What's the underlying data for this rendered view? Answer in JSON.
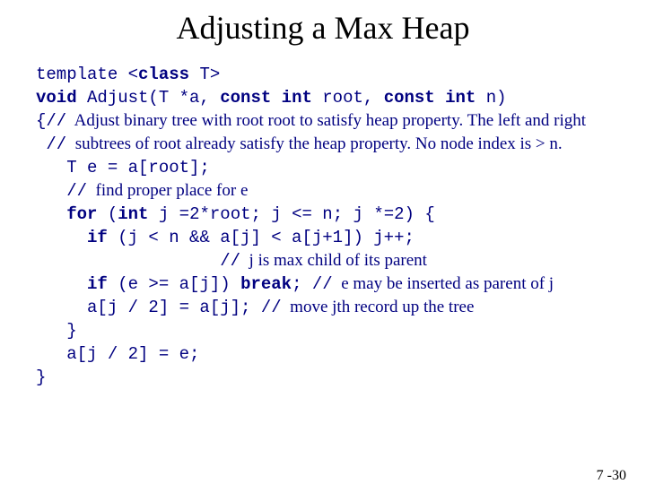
{
  "title": "Adjusting a Max Heap",
  "page_number": "7 -30",
  "code": {
    "l1a": "template ",
    "l1b": "<",
    "l1c": "class",
    "l1d": " T>",
    "l2a": "void",
    "l2b": " Adjust(T *a, ",
    "l2c": "const int",
    "l2d": " root, ",
    "l2e": "const int",
    "l2f": " n)",
    "l3a": "{",
    "l3b": "//",
    "c3": "  Adjust binary tree with root root to satisfy heap property. The left and right",
    "l4a": " //",
    "c4": "  subtrees of root already satisfy the heap property. No node index is > n.",
    "l5": "   T e = a[root];",
    "l6a": "   ",
    "l6b": "//",
    "c6": "  find proper place for e",
    "l7a": "   ",
    "l7b": "for",
    "l7c": " (",
    "l7d": "int",
    "l7e": " j =",
    "l7f": "2",
    "l7g": "*root; j <= n; j *=",
    "l7h": "2",
    "l7i": ") {",
    "l8a": "     ",
    "l8b": "if",
    "l8c": " (j < n && a[j] < a[j+",
    "l8d": "1",
    "l8e": "]) j++;",
    "l9a": "                  ",
    "l9b": "//",
    "c9": "  j is max child of its parent",
    "l10a": "     ",
    "l10b": "if",
    "l10c": " (e >= a[j]) ",
    "l10d": "break",
    "l10e": "; ",
    "l10f": "//",
    "c10": "  e may be inserted as parent of j",
    "l11a": "     a[j / ",
    "l11b": "2",
    "l11c": "] = a[j]; ",
    "l11d": "//",
    "c11": "  move jth record up the tree",
    "l12": "   }",
    "l13a": "   a[j / ",
    "l13b": "2",
    "l13c": "] = e;",
    "l14": "}"
  }
}
